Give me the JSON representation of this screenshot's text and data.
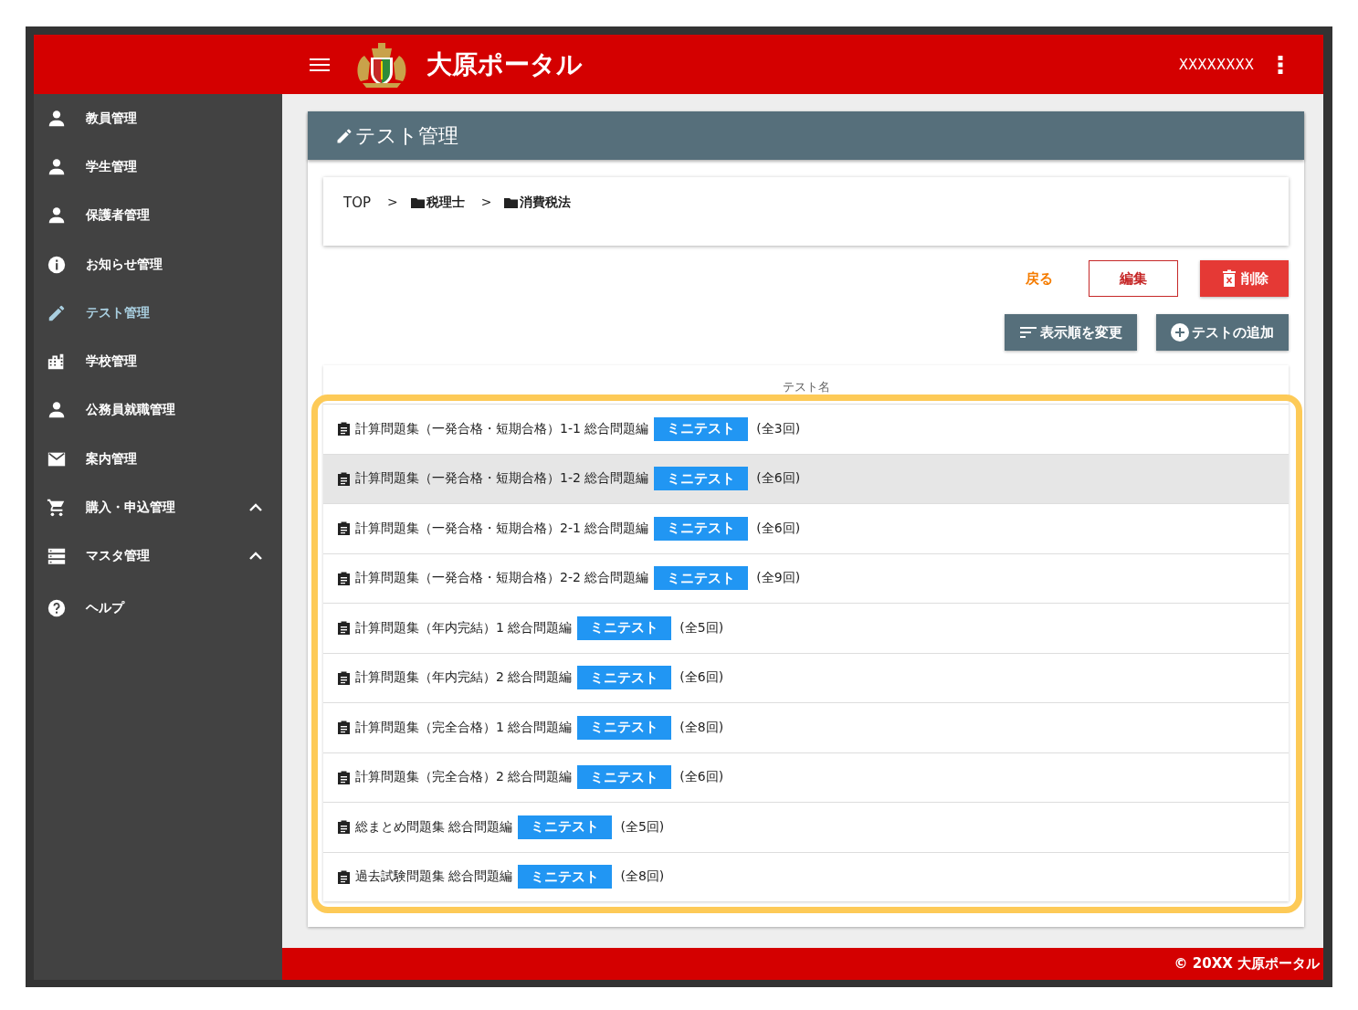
{
  "header": {
    "title": "大原ポータル",
    "user": "XXXXXXXX"
  },
  "sidebar": {
    "items": [
      {
        "label": "教員管理",
        "selected": false
      },
      {
        "label": "学生管理",
        "selected": false
      },
      {
        "label": "保護者管理",
        "selected": false
      },
      {
        "label": "お知らせ管理",
        "selected": false
      },
      {
        "label": "テスト管理",
        "selected": true
      },
      {
        "label": "学校管理",
        "selected": false
      },
      {
        "label": "公務員就職管理",
        "selected": false
      },
      {
        "label": "案内管理",
        "selected": false
      },
      {
        "label": "購入・申込管理",
        "selected": false,
        "expanded": true
      },
      {
        "label": "マスタ管理",
        "selected": false,
        "expanded": true
      },
      {
        "label": "ヘルプ",
        "selected": false
      }
    ]
  },
  "page": {
    "title": "テスト管理"
  },
  "breadcrumb": [
    {
      "label": "TOP",
      "kind": "home"
    },
    {
      "label": ">",
      "kind": "separator"
    },
    {
      "label": "税理士",
      "kind": "folder"
    },
    {
      "label": ">",
      "kind": "separator"
    },
    {
      "label": "消費税法",
      "kind": "folder"
    }
  ],
  "actions": [
    {
      "label": "戻る",
      "kind": "text"
    },
    {
      "label": "編集",
      "kind": "outlined"
    },
    {
      "label": "削除",
      "kind": "danger"
    }
  ],
  "actions2": [
    {
      "label": "表示順を変更",
      "kind": "sort"
    },
    {
      "label": "テストの追加",
      "kind": "add"
    }
  ],
  "table": {
    "columns": [
      "テスト名"
    ],
    "highlighted": true,
    "rows": [
      {
        "name": "計算問題集（一発合格・短期合格）1-1 総合問題編",
        "tag": "ミニテスト",
        "count": "(全3回)",
        "hovered": false
      },
      {
        "name": "計算問題集（一発合格・短期合格）1-2 総合問題編",
        "tag": "ミニテスト",
        "count": "(全6回)",
        "hovered": true
      },
      {
        "name": "計算問題集（一発合格・短期合格）2-1 総合問題編",
        "tag": "ミニテスト",
        "count": "(全6回)",
        "hovered": false
      },
      {
        "name": "計算問題集（一発合格・短期合格）2-2 総合問題編",
        "tag": "ミニテスト",
        "count": "(全9回)",
        "hovered": false
      },
      {
        "name": "計算問題集（年内完結）1 総合問題編",
        "tag": "ミニテスト",
        "count": "(全5回)",
        "hovered": false
      },
      {
        "name": "計算問題集（年内完結）2 総合問題編",
        "tag": "ミニテスト",
        "count": "(全6回)",
        "hovered": false
      },
      {
        "name": "計算問題集（完全合格）1 総合問題編",
        "tag": "ミニテスト",
        "count": "(全8回)",
        "hovered": false
      },
      {
        "name": "計算問題集（完全合格）2 総合問題編",
        "tag": "ミニテスト",
        "count": "(全6回)",
        "hovered": false
      },
      {
        "name": "総まとめ問題集 総合問題編",
        "tag": "ミニテスト",
        "count": "(全5回)",
        "hovered": false
      },
      {
        "name": "過去試験問題集 総合問題編",
        "tag": "ミニテスト",
        "count": "(全8回)",
        "hovered": false
      }
    ]
  },
  "footer": {
    "text": "© 20XX 大原ポータル"
  }
}
